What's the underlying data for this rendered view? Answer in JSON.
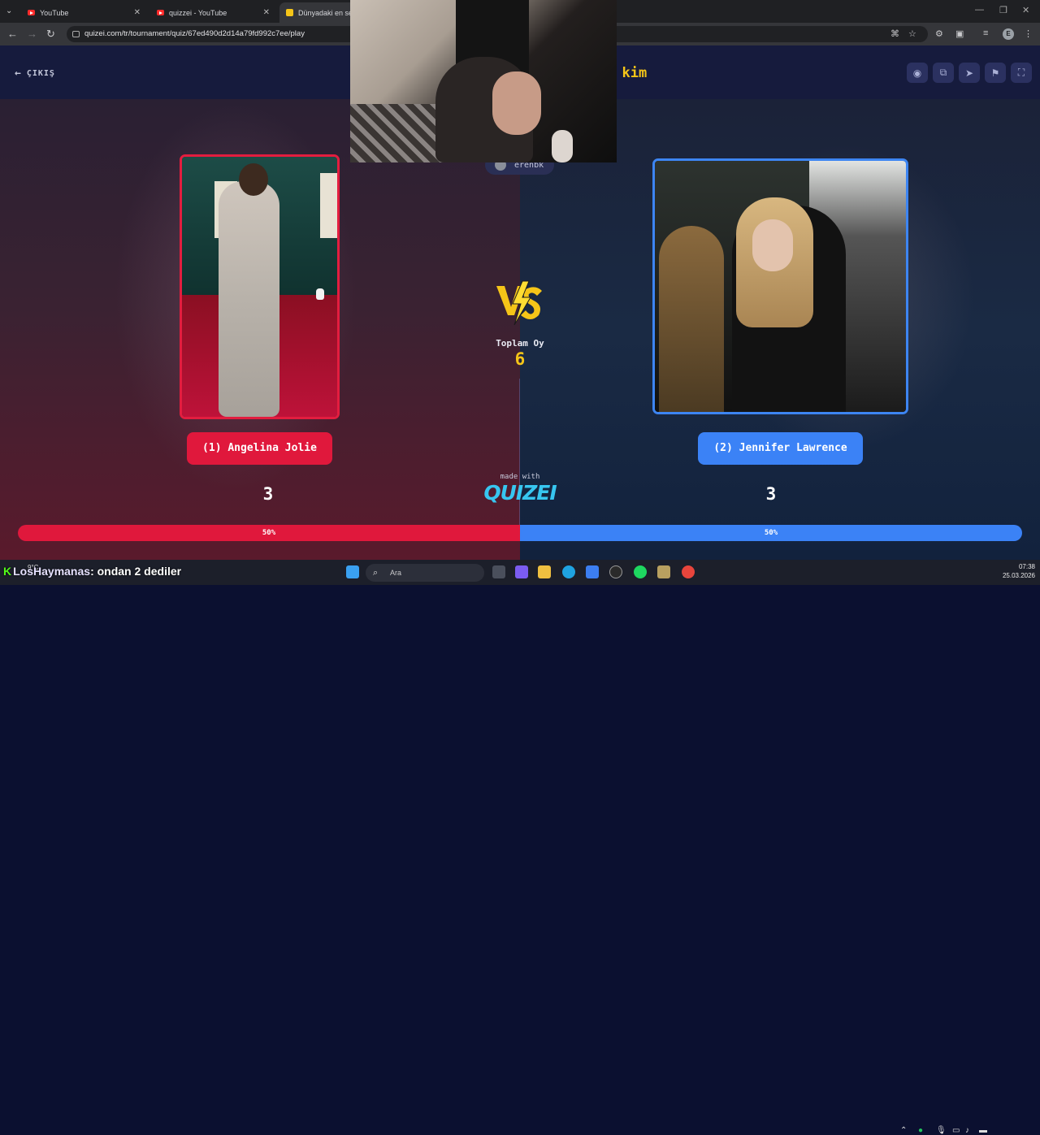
{
  "browser": {
    "tabs": [
      {
        "title": "YouTube",
        "active": false
      },
      {
        "title": "quizzei - YouTube",
        "active": false
      },
      {
        "title": "Dünyadaki en seks",
        "active": true
      }
    ],
    "url": "quizei.com/tr/tournament/quiz/67ed490d2d14a79fd992c7ee/play",
    "profile_initial": "E"
  },
  "page": {
    "exit_label": "ÇIKIŞ",
    "title_fragment": "n kim",
    "toolbar_icons": [
      "eye-icon",
      "share-icon",
      "send-icon",
      "flag-icon",
      "fullscreen-icon"
    ],
    "streamer_name": "erenbk",
    "vs_label": "VS",
    "total_votes_label": "Toplam Oy",
    "total_votes": "6",
    "left": {
      "label": "(1) Angelina Jolie",
      "votes": "3",
      "percent_label": "50%",
      "fraction": 0.5,
      "color": "#e0183c"
    },
    "right": {
      "label": "(2) Jennifer Lawrence",
      "votes": "3",
      "percent_label": "50%",
      "fraction": 0.5,
      "color": "#3b82f6"
    },
    "made_with": "made with",
    "brand": "QUIZEI"
  },
  "taskbar": {
    "weather": "9°C",
    "search_placeholder": "Ara",
    "time": "07:38",
    "date": "25.03.2026"
  },
  "chat_overlay": {
    "user": "LosHaymanas",
    "message": ": ondan 2 dediler"
  }
}
